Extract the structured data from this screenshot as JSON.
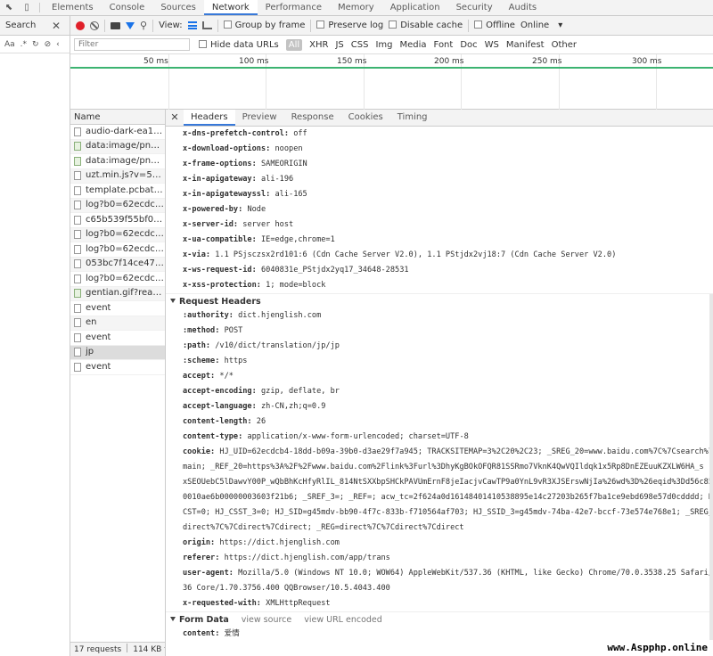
{
  "main_tabs": [
    "Elements",
    "Console",
    "Sources",
    "Network",
    "Performance",
    "Memory",
    "Application",
    "Security",
    "Audits"
  ],
  "search": {
    "title": "Search",
    "case_label": "Aa",
    "regex_label": ".*"
  },
  "toolbar": {
    "view_label": "View:",
    "group_by_frame": "Group by frame",
    "preserve_log": "Preserve log",
    "disable_cache": "Disable cache",
    "offline": "Offline",
    "throttle": "Online"
  },
  "filter": {
    "placeholder": "Filter",
    "hide_data_urls": "Hide data URLs",
    "all": "All",
    "types": [
      "XHR",
      "JS",
      "CSS",
      "Img",
      "Media",
      "Font",
      "Doc",
      "WS",
      "Manifest",
      "Other"
    ]
  },
  "timeline": {
    "ticks": [
      "50 ms",
      "100 ms",
      "150 ms",
      "200 ms",
      "250 ms",
      "300 ms"
    ]
  },
  "request_list": {
    "header": "Name",
    "rows": [
      "audio-dark-ea178...",
      "data:image/png;ba...",
      "data:image/png;ba...",
      "uzt.min.js?v=53828...",
      "template.pcbatch?...",
      "log?b0=62ecdcb4-...",
      "c65b539f55bf062ff...",
      "log?b0=62ecdcb4-...",
      "log?b0=62ecdcb4-...",
      "053bc7f14ce4758f...",
      "log?b0=62ecdcb4-...",
      "gentian.gif?ready_t...",
      "event",
      "en",
      "event",
      "jp",
      "event"
    ],
    "footer_requests": "17 requests",
    "footer_size": "114 KB t..."
  },
  "detail_tabs": [
    "Headers",
    "Preview",
    "Response",
    "Cookies",
    "Timing"
  ],
  "response_headers": [
    {
      "k": "x-dns-prefetch-control:",
      "v": "off"
    },
    {
      "k": "x-download-options:",
      "v": "noopen"
    },
    {
      "k": "x-frame-options:",
      "v": "SAMEORIGIN"
    },
    {
      "k": "x-in-apigateway:",
      "v": "ali-196"
    },
    {
      "k": "x-in-apigatewayssl:",
      "v": "ali-165"
    },
    {
      "k": "x-powered-by:",
      "v": "Node"
    },
    {
      "k": "x-server-id:",
      "v": "server host"
    },
    {
      "k": "x-ua-compatible:",
      "v": "IE=edge,chrome=1"
    },
    {
      "k": "x-via:",
      "v": "1.1 PSjsczsx2rd101:6 (Cdn Cache Server V2.0), 1.1 PStjdx2vj18:7 (Cdn Cache Server V2.0)"
    },
    {
      "k": "x-ws-request-id:",
      "v": "6040831e_PStjdx2yq17_34648-28531"
    },
    {
      "k": "x-xss-protection:",
      "v": "1; mode=block"
    }
  ],
  "request_headers_title": "Request Headers",
  "request_headers": [
    {
      "k": ":authority:",
      "v": "dict.hjenglish.com"
    },
    {
      "k": ":method:",
      "v": "POST"
    },
    {
      "k": ":path:",
      "v": "/v10/dict/translation/jp/jp"
    },
    {
      "k": ":scheme:",
      "v": "https"
    },
    {
      "k": "accept:",
      "v": "*/*"
    },
    {
      "k": "accept-encoding:",
      "v": "gzip, deflate, br"
    },
    {
      "k": "accept-language:",
      "v": "zh-CN,zh;q=0.9"
    },
    {
      "k": "content-length:",
      "v": "26"
    },
    {
      "k": "content-type:",
      "v": "application/x-www-form-urlencoded; charset=UTF-8"
    }
  ],
  "cookie": {
    "k": "cookie:",
    "lines": [
      "HJ_UID=62ecdcb4-18dd-b09a-39b0-d3ae29f7a945; TRACKSITEMAP=3%2C20%2C23; _SREG_20=www.baidu.com%7C%7Csearch%7C",
      "main; _REF_20=https%3A%2F%2Fwww.baidu.com%2Flink%3Furl%3DhyKgBOkOFQR81SSRmo7VknK4QwVQIldqk1x5Rp8DnEZEuuKZXLW6HA_s",
      "xSEOUebC5lDawvY00P_wQbBhKcHfyRlIL_814NtSXXbpSHCkPAVUmErnF8jeIacjvCawTP9a0YnL9vR3XJSErswNjIa%26wd%3D%26eqid%3Dd56c85",
      "0010ae6b00000003603f21b6; _SREF_3=; _REF=; acw_tc=2f624a0d16148401410538895e14c27203b265f7ba1ce9ebd698e57d0cdddd; H",
      "CST=0; HJ_CSST_3=0; HJ_SID=g45mdv-bb90-4f7c-833b-f710564af703; HJ_SSID_3=g45mdv-74ba-42e7-bccf-73e574e768e1; _SREG_",
      "direct%7C%7Cdirect%7Cdirect; _REG=direct%7C%7Cdirect%7Cdirect"
    ]
  },
  "request_headers_tail": [
    {
      "k": "origin:",
      "v": "https://dict.hjenglish.com"
    },
    {
      "k": "referer:",
      "v": "https://dict.hjenglish.com/app/trans"
    },
    {
      "k": "user-agent:",
      "v": "Mozilla/5.0 (Windows NT 10.0; WOW64) AppleWebKit/537.36 (KHTML, like Gecko) Chrome/70.0.3538.25 Safari/53"
    },
    {
      "k": "",
      "v": "36 Core/1.70.3756.400 QQBrowser/10.5.4043.400"
    },
    {
      "k": "x-requested-with:",
      "v": "XMLHttpRequest"
    }
  ],
  "form_data": {
    "title": "Form Data",
    "view_source": "view source",
    "view_url_encoded": "view URL encoded",
    "content_k": "content:",
    "content_v": "爱情"
  },
  "watermark": "www.Aspphp.online"
}
